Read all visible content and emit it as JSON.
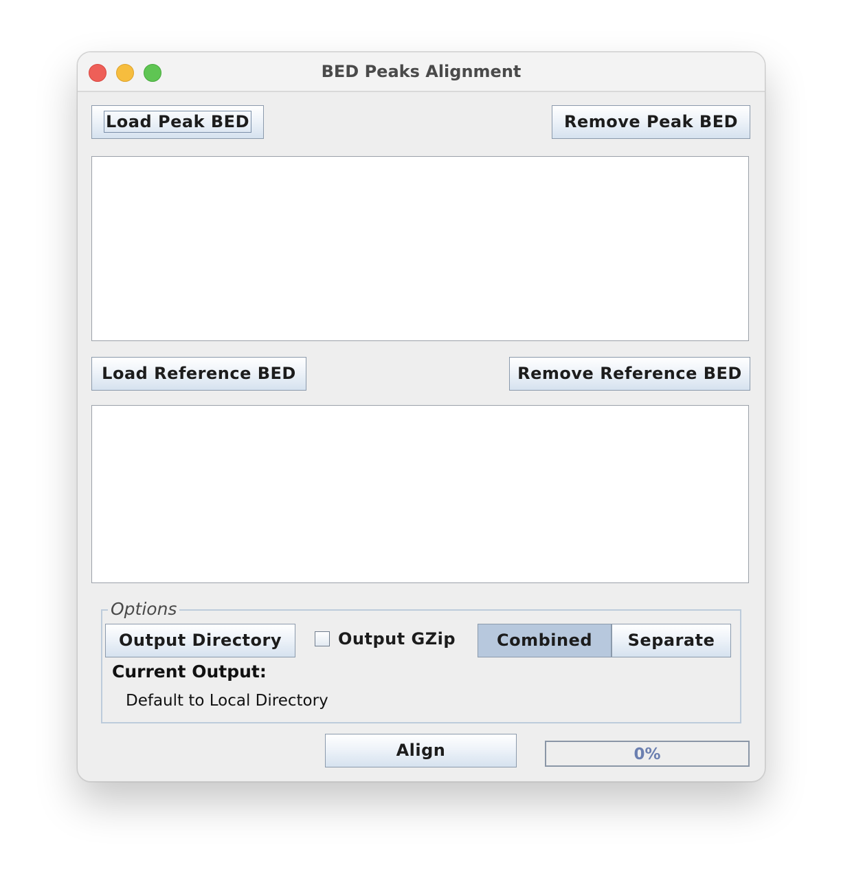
{
  "window": {
    "title": "BED Peaks Alignment"
  },
  "peak": {
    "load_label": "Load Peak BED",
    "remove_label": "Remove Peak BED",
    "items": []
  },
  "reference": {
    "load_label": "Load Reference BED",
    "remove_label": "Remove Reference BED",
    "items": []
  },
  "options": {
    "legend": "Options",
    "output_directory_label": "Output Directory",
    "gzip_label": "Output GZip",
    "gzip_checked": false,
    "combined_label": "Combined",
    "separate_label": "Separate",
    "mode_selected": "Combined",
    "current_output_label": "Current Output:",
    "current_output_value": "Default to Local Directory"
  },
  "actions": {
    "align_label": "Align"
  },
  "progress": {
    "value": 0,
    "text": "0%"
  },
  "colors": {
    "close": "#ee5f58",
    "minimize": "#f6bd3e",
    "maximize": "#5fc553",
    "selected_toggle": "#b7c8dd",
    "progress_text": "#6b7fb0"
  }
}
